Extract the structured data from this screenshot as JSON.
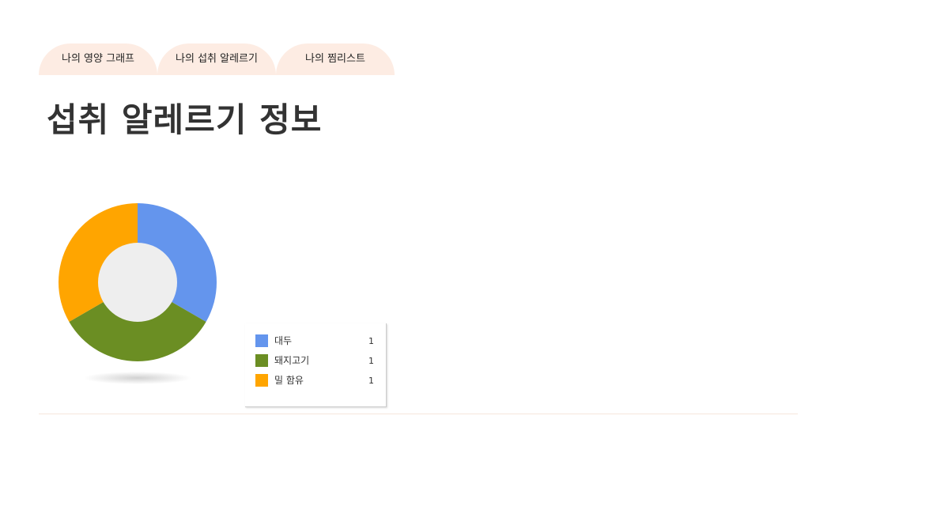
{
  "tabs": [
    {
      "label": "나의 영양 그래프"
    },
    {
      "label": "나의 섭취 알레르기"
    },
    {
      "label": "나의 찜리스트"
    }
  ],
  "page_title": "섭취 알레르기 정보",
  "colors": {
    "tab_bg": "#fdece3",
    "donut_hole": "#eeeeee",
    "divider": "#f6e6dc"
  },
  "chart_data": {
    "type": "pie",
    "donut": true,
    "legend_position": "bottom-right",
    "categories": [
      "대두",
      "돼지고기",
      "밀 함유"
    ],
    "values": [
      1,
      1,
      1
    ],
    "colors": [
      "#6495ed",
      "#6b8e23",
      "#ffa500"
    ]
  }
}
